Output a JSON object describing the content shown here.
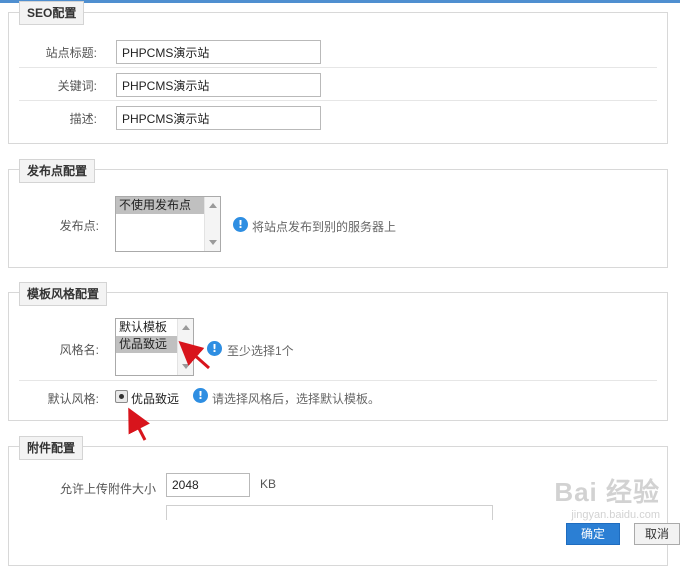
{
  "seo": {
    "legend": "SEO配置",
    "site_title_label": "站点标题:",
    "site_title_value": "PHPCMS演示站",
    "keywords_label": "关键词:",
    "keywords_value": "PHPCMS演示站",
    "description_label": "描述:",
    "description_value": "PHPCMS演示站"
  },
  "publish": {
    "legend": "发布点配置",
    "label": "发布点:",
    "options": [
      "不使用发布点"
    ],
    "hint": "将站点发布到别的服务器上"
  },
  "template": {
    "legend": "模板风格配置",
    "style_label": "风格名:",
    "style_options": [
      "默认模板",
      "优品致远"
    ],
    "selected_style": "优品致远",
    "style_hint": "至少选择1个",
    "default_label": "默认风格:",
    "default_option": "优品致远",
    "default_hint": "请选择风格后，选择默认模板。"
  },
  "attachment": {
    "legend": "附件配置",
    "upload_size_label": "允许上传附件大小",
    "upload_size_value": "2048",
    "upload_size_unit": "KB"
  },
  "buttons": {
    "ok": "确定",
    "cancel": "取消"
  },
  "icons": {
    "info": "info-icon",
    "annotation": "red-arrow-icon"
  },
  "watermark": {
    "brand": "Bai 经验",
    "url": "jingyan.baidu.com"
  },
  "colors": {
    "accent": "#2b7fd4",
    "info": "#2e8ee2",
    "annotation_arrow": "#d8141c"
  }
}
